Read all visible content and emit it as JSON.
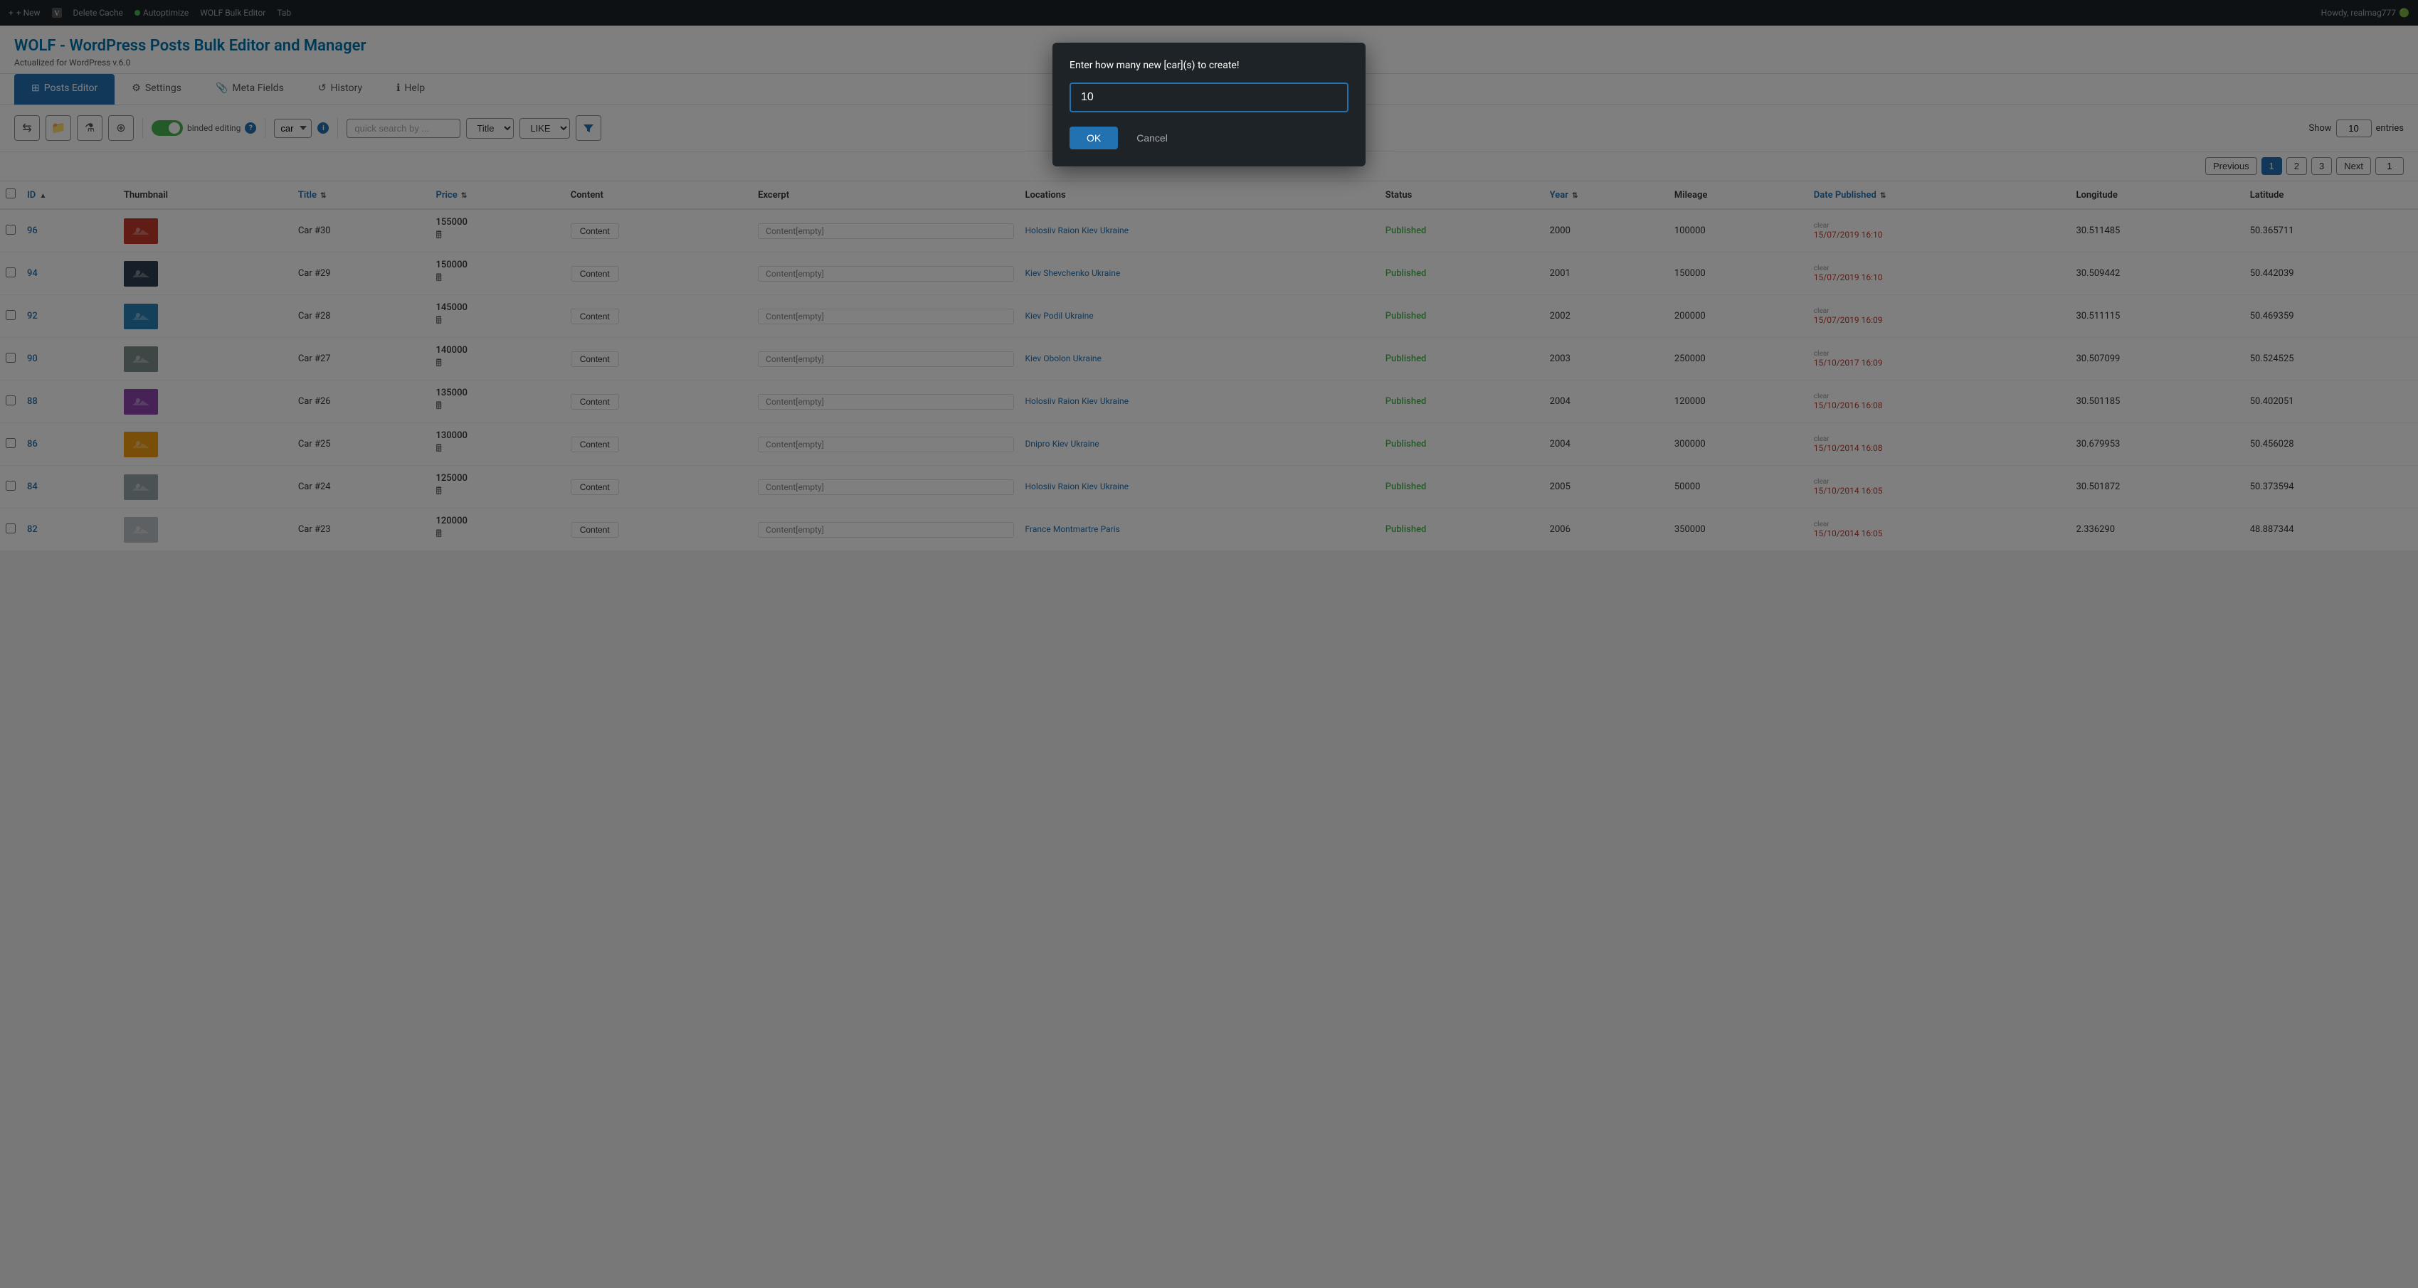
{
  "adminBar": {
    "items": [
      {
        "label": "+ New",
        "name": "new"
      },
      {
        "label": "V",
        "name": "v-logo"
      },
      {
        "label": "Delete Cache",
        "name": "delete-cache"
      },
      {
        "label": "Autoptimize",
        "name": "autoptimize",
        "hasGreenDot": true
      },
      {
        "label": "WOLF Bulk Editor",
        "name": "wolf-bulk-editor"
      },
      {
        "label": "Tab",
        "name": "tab"
      }
    ],
    "right": "Howdy, realmag777"
  },
  "pageHeader": {
    "title": "WOLF - WordPress Posts Bulk Editor and Manager",
    "subtitle": "Actualized for WordPress v.6.0"
  },
  "tabs": [
    {
      "label": "Posts Editor",
      "icon": "grid",
      "active": true
    },
    {
      "label": "Settings",
      "icon": "gear"
    },
    {
      "label": "Meta Fields",
      "icon": "paperclip"
    },
    {
      "label": "History",
      "icon": "history"
    },
    {
      "label": "Help",
      "icon": "info"
    }
  ],
  "toolbar": {
    "bindedEditing": "binded editing",
    "postType": "car",
    "searchPlaceholder": "quick search by ...",
    "searchField": "Title",
    "searchOperator": "LIKE",
    "showLabel": "Show",
    "showValue": "10",
    "entriesLabel": "entries"
  },
  "pagination": {
    "previousLabel": "Previous",
    "nextLabel": "Next",
    "pages": [
      "1",
      "2",
      "3"
    ],
    "activePage": "1",
    "currentPageInput": "1"
  },
  "table": {
    "columns": [
      {
        "key": "id",
        "label": "ID",
        "sortable": true,
        "sortDir": "asc"
      },
      {
        "key": "thumbnail",
        "label": "Thumbnail",
        "sortable": false
      },
      {
        "key": "title",
        "label": "Title",
        "sortable": true
      },
      {
        "key": "price",
        "label": "Price",
        "sortable": true
      },
      {
        "key": "content",
        "label": "Content",
        "sortable": false
      },
      {
        "key": "excerpt",
        "label": "Excerpt",
        "sortable": false
      },
      {
        "key": "locations",
        "label": "Locations",
        "sortable": false
      },
      {
        "key": "status",
        "label": "Status",
        "sortable": false
      },
      {
        "key": "year",
        "label": "Year",
        "sortable": true
      },
      {
        "key": "mileage",
        "label": "Mileage",
        "sortable": false
      },
      {
        "key": "datePublished",
        "label": "Date Published",
        "sortable": true
      },
      {
        "key": "longitude",
        "label": "Longitude",
        "sortable": false
      },
      {
        "key": "latitude",
        "label": "Latitude",
        "sortable": false
      }
    ],
    "rows": [
      {
        "id": "96",
        "title": "Car #30",
        "price": "155000",
        "content": "Content",
        "excerpt": "Content[empty]",
        "locations": [
          "Holosiiv Raion",
          "Kiev",
          "Ukraine"
        ],
        "status": "Published",
        "year": "2000",
        "mileage": "100000",
        "datePublished": "15/07/2019 16:10",
        "longitude": "30.511485",
        "latitude": "50.365711",
        "thumbColor": "#c0392b"
      },
      {
        "id": "94",
        "title": "Car #29",
        "price": "150000",
        "content": "Content",
        "excerpt": "Content[empty]",
        "locations": [
          "Kiev",
          "Shevchenko",
          "Ukraine"
        ],
        "status": "Published",
        "year": "2001",
        "mileage": "150000",
        "datePublished": "15/07/2019 16:10",
        "longitude": "30.509442",
        "latitude": "50.442039",
        "thumbColor": "#2c3e50"
      },
      {
        "id": "92",
        "title": "Car #28",
        "price": "145000",
        "content": "Content",
        "excerpt": "Content[empty]",
        "locations": [
          "Kiev",
          "Podil",
          "Ukraine"
        ],
        "status": "Published",
        "year": "2002",
        "mileage": "200000",
        "datePublished": "15/07/2019 16:09",
        "longitude": "30.511115",
        "latitude": "50.469359",
        "thumbColor": "#2980b9"
      },
      {
        "id": "90",
        "title": "Car #27",
        "price": "140000",
        "content": "Content",
        "excerpt": "Content[empty]",
        "locations": [
          "Kiev",
          "Obolon",
          "Ukraine"
        ],
        "status": "Published",
        "year": "2003",
        "mileage": "250000",
        "datePublished": "15/10/2017 16:09",
        "longitude": "30.507099",
        "latitude": "50.524525",
        "thumbColor": "#7f8c8d"
      },
      {
        "id": "88",
        "title": "Car #26",
        "price": "135000",
        "content": "Content",
        "excerpt": "Content[empty]",
        "locations": [
          "Holosiiv Raion",
          "Kiev",
          "Ukraine"
        ],
        "status": "Published",
        "year": "2004",
        "mileage": "120000",
        "datePublished": "15/10/2016 16:08",
        "longitude": "30.501185",
        "latitude": "50.402051",
        "thumbColor": "#8e44ad"
      },
      {
        "id": "86",
        "title": "Car #25",
        "price": "130000",
        "content": "Content",
        "excerpt": "Content[empty]",
        "locations": [
          "Dnipro",
          "Kiev",
          "Ukraine"
        ],
        "status": "Published",
        "year": "2004",
        "mileage": "300000",
        "datePublished": "15/10/2014 16:08",
        "longitude": "30.679953",
        "latitude": "50.456028",
        "thumbColor": "#f39c12"
      },
      {
        "id": "84",
        "title": "Car #24",
        "price": "125000",
        "content": "Content",
        "excerpt": "Content[empty]",
        "locations": [
          "Holosiiv Raion",
          "Kiev",
          "Ukraine"
        ],
        "status": "Published",
        "year": "2005",
        "mileage": "50000",
        "datePublished": "15/10/2014 16:05",
        "longitude": "30.501872",
        "latitude": "50.373594",
        "thumbColor": "#95a5a6"
      },
      {
        "id": "82",
        "title": "Car #23",
        "price": "120000",
        "content": "Content",
        "excerpt": "Content[empty]",
        "locations": [
          "France",
          "Montmartre",
          "Paris"
        ],
        "status": "Published",
        "year": "2006",
        "mileage": "350000",
        "datePublished": "15/10/2014 16:05",
        "longitude": "2.336290",
        "latitude": "48.887344",
        "thumbColor": "#bdc3c7"
      }
    ]
  },
  "modal": {
    "title": "Enter how many new [car](s) to create!",
    "inputValue": "10",
    "okLabel": "OK",
    "cancelLabel": "Cancel"
  },
  "colors": {
    "primary": "#2271b1",
    "published": "#46b450",
    "dateLink": "#c0392b",
    "locationLink": "#2271b1"
  }
}
